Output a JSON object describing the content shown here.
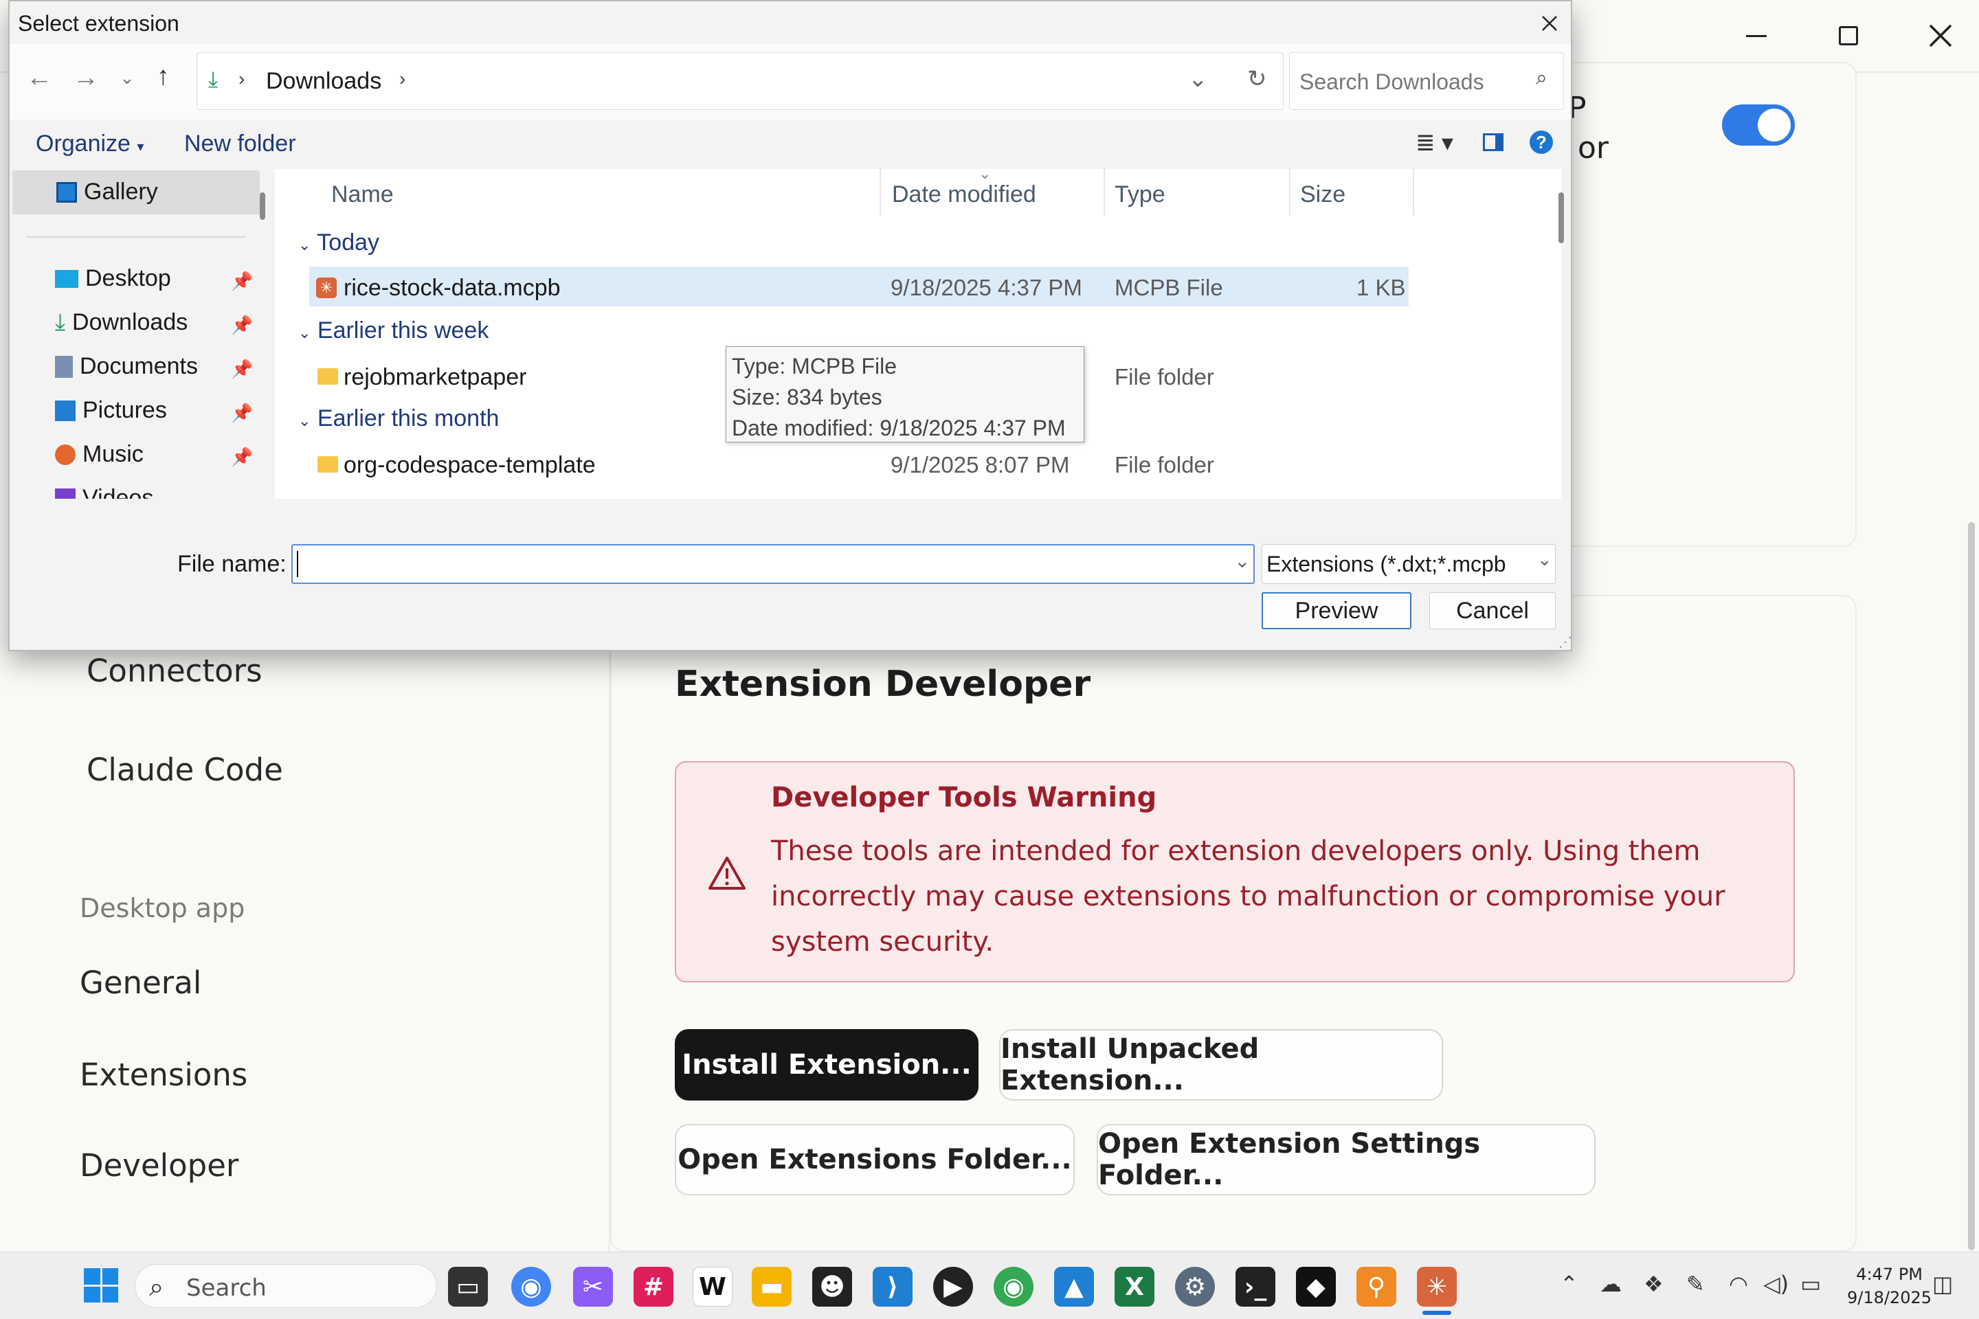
{
  "dialog": {
    "title": "Select extension",
    "breadcrumb": "Downloads",
    "search_placeholder": "Search Downloads",
    "organize": "Organize",
    "new_folder": "New folder",
    "sidebar": [
      {
        "label": "Gallery"
      },
      {
        "label": "Desktop"
      },
      {
        "label": "Downloads"
      },
      {
        "label": "Documents"
      },
      {
        "label": "Pictures"
      },
      {
        "label": "Music"
      },
      {
        "label": "Videos"
      }
    ],
    "columns": {
      "name": "Name",
      "date": "Date modified",
      "type": "Type",
      "size": "Size"
    },
    "groups": {
      "today": "Today",
      "week": "Earlier this week",
      "month": "Earlier this month"
    },
    "files": [
      {
        "name": "rice-stock-data.mcpb",
        "date": "9/18/2025 4:37 PM",
        "type": "MCPB File",
        "size": "1 KB"
      },
      {
        "name": "rejobmarketpaper",
        "date": "",
        "type": "File folder",
        "size": ""
      },
      {
        "name": "org-codespace-template",
        "date": "9/1/2025 8:07 PM",
        "type": "File folder",
        "size": ""
      }
    ],
    "tooltip": {
      "type": "Type: MCPB File",
      "size": "Size: 834 bytes",
      "date": "Date modified: 9/18/2025 4:37 PM"
    },
    "file_name_label": "File name:",
    "file_name_value": "",
    "filter": "Extensions (*.dxt;*.mcpb",
    "preview_button": "Preview",
    "cancel_button": "Cancel"
  },
  "app": {
    "partial_text_1": "P",
    "partial_text_2": "or",
    "sidebar_links": {
      "connectors": "Connectors",
      "claude_code": "Claude Code",
      "section_label": "Desktop app",
      "general": "General",
      "extensions": "Extensions",
      "developer": "Developer"
    },
    "heading": "Extension Developer",
    "warning": {
      "title": "Developer Tools Warning",
      "body": "These tools are intended for extension developers only. Using them incorrectly may cause extensions to malfunction or compromise your system security."
    },
    "buttons": {
      "install": "Install Extension...",
      "install_unpacked": "Install Unpacked Extension...",
      "open_folder": "Open Extensions Folder...",
      "open_settings_folder": "Open Extension Settings Folder..."
    },
    "toggle_on": true,
    "accent_color": "#2f7ae5"
  },
  "taskbar": {
    "search_placeholder": "Search",
    "time": "4:47 PM",
    "date": "9/18/2025"
  }
}
